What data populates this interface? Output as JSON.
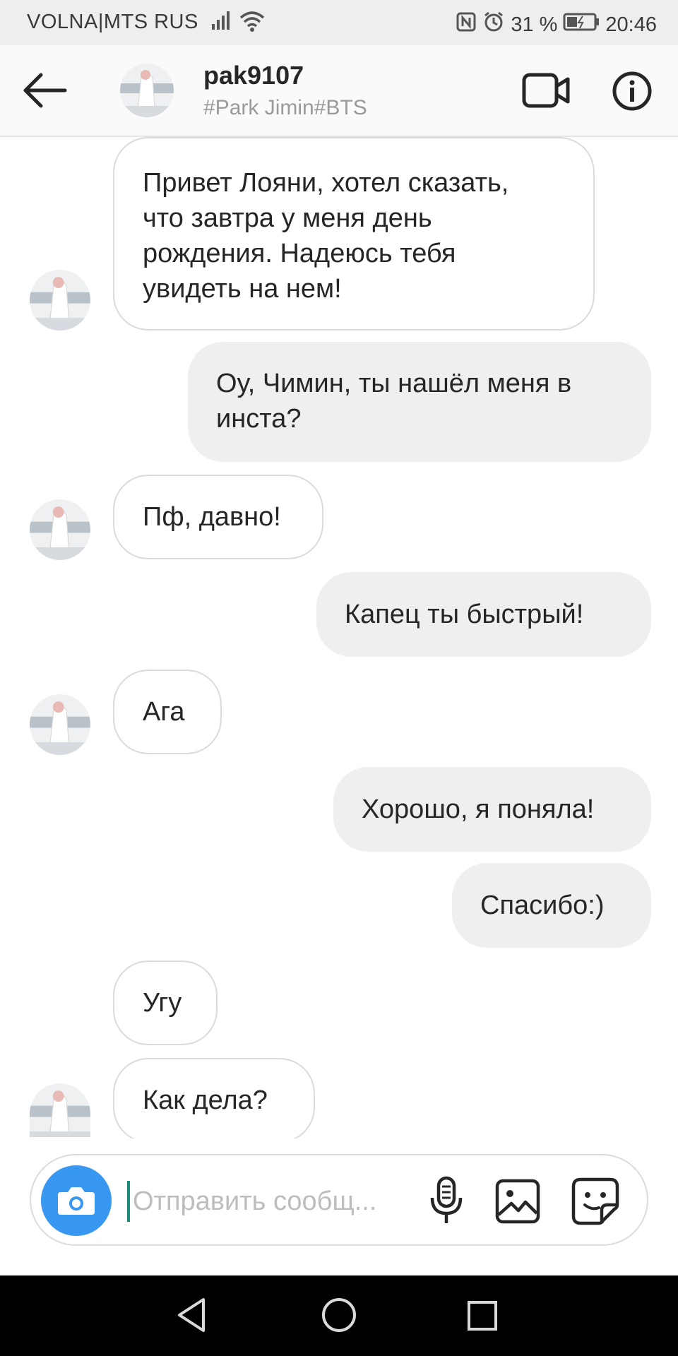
{
  "status_bar": {
    "carrier": "VOLNA|MTS RUS",
    "battery": "31 %",
    "time": "20:46"
  },
  "header": {
    "username": "pak9107",
    "subtitle": "#Park Jimin#BTS"
  },
  "messages": [
    {
      "side": "in",
      "lines": [
        "Привет Лояни, хотел сказать,",
        "что завтра у меня день",
        "рождения. Надеюсь тебя",
        "увидеть на нем!"
      ]
    },
    {
      "side": "out",
      "lines": [
        "Оу, Чимин, ты нашёл меня в",
        "инста?"
      ]
    },
    {
      "side": "in",
      "lines": [
        "Пф, давно!"
      ]
    },
    {
      "side": "out",
      "lines": [
        "Капец ты быстрый!"
      ]
    },
    {
      "side": "in",
      "lines": [
        "Ага"
      ]
    },
    {
      "side": "out",
      "lines": [
        "Хорошо, я поняла!"
      ]
    },
    {
      "side": "out",
      "lines": [
        "Спасибо:)"
      ]
    },
    {
      "side": "in",
      "lines": [
        "Угу"
      ]
    },
    {
      "side": "in",
      "lines": [
        "Как дела?"
      ]
    }
  ],
  "composer": {
    "placeholder": "Отправить сообщ..."
  },
  "icons": {
    "back": "arrow-left-icon",
    "video": "video-camera-icon",
    "info": "info-icon",
    "camera": "camera-icon",
    "mic": "microphone-icon",
    "gallery": "image-icon",
    "sticker": "sticker-icon"
  },
  "colors": {
    "accent": "#3897f0",
    "incoming_bubble_border": "#dbdbdb",
    "outgoing_bubble_bg": "#efefef"
  }
}
